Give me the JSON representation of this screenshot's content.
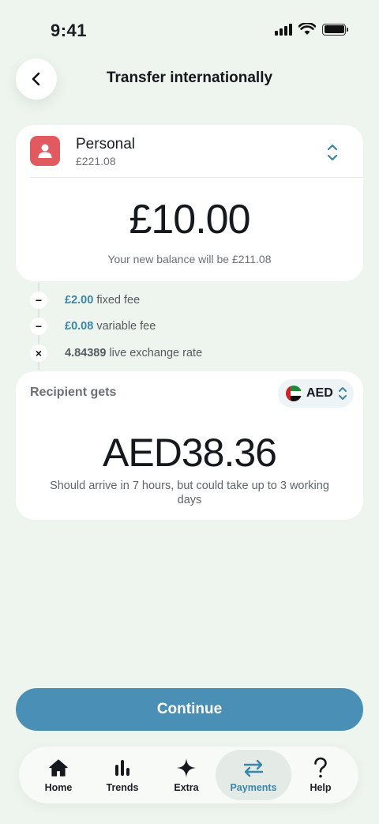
{
  "status_bar": {
    "time": "9:41"
  },
  "header": {
    "title": "Transfer internationally"
  },
  "account": {
    "name": "Personal",
    "balance": "£221.08",
    "amount": "£10.00",
    "new_balance_text": "Your new balance will be £211.08"
  },
  "fees": [
    {
      "symbol": "−",
      "amount": "£2.00",
      "label": " fixed fee"
    },
    {
      "symbol": "−",
      "amount": "£0.08",
      "label": " variable fee"
    },
    {
      "symbol": "×",
      "amount": "4.84389",
      "label": " live exchange rate"
    }
  ],
  "recipient": {
    "label": "Recipient gets",
    "currency": "AED",
    "amount": "AED38.36",
    "arrival_text": "Should arrive in 7 hours, but could take up to 3 working days"
  },
  "continue_label": "Continue",
  "tabs": [
    {
      "label": "Home",
      "icon": "home-icon"
    },
    {
      "label": "Trends",
      "icon": "bar-chart-icon"
    },
    {
      "label": "Extra",
      "icon": "sparkle-icon"
    },
    {
      "label": "Payments",
      "icon": "transfer-arrows-icon",
      "active": true
    },
    {
      "label": "Help",
      "icon": "question-mark-icon"
    }
  ],
  "colors": {
    "accent": "#4a90b6",
    "avatar": "#e05a5f",
    "background": "#eef4ee"
  }
}
